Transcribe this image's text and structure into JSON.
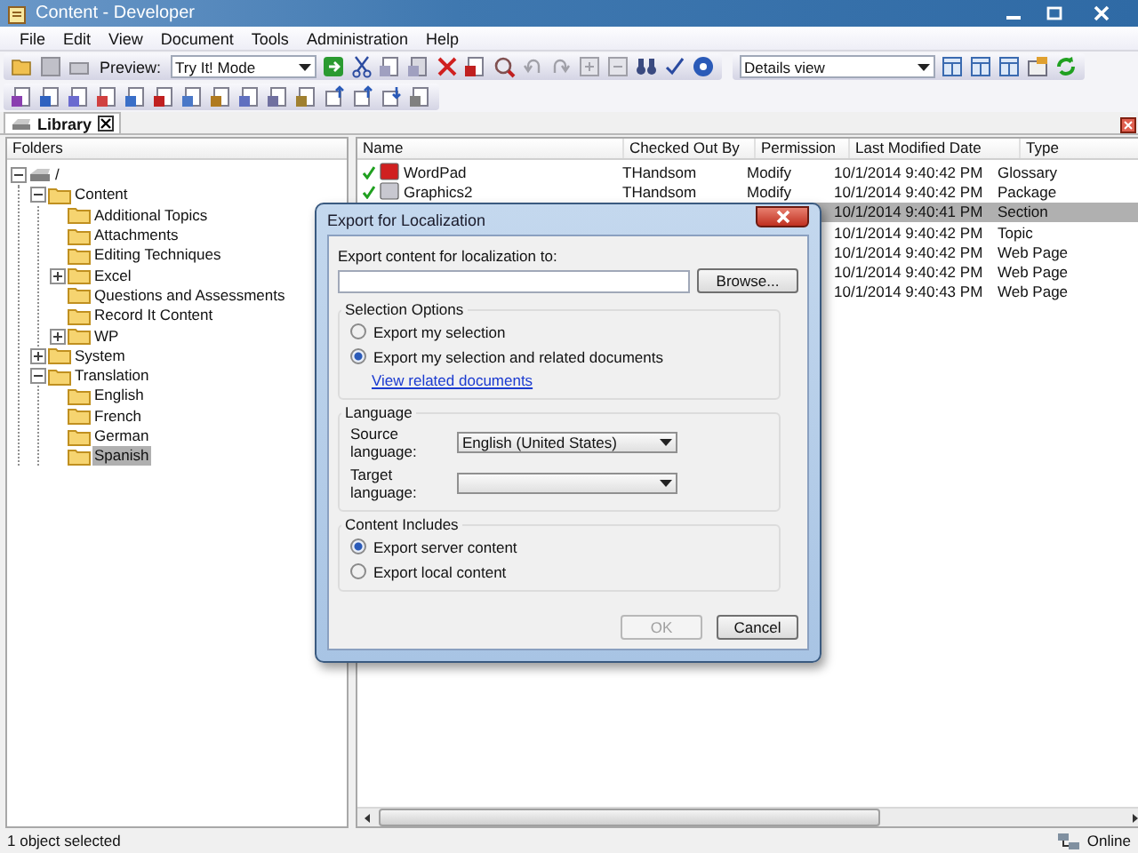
{
  "window": {
    "title": "Content - Developer"
  },
  "menu": [
    "File",
    "Edit",
    "View",
    "Document",
    "Tools",
    "Administration",
    "Help"
  ],
  "toolbar": {
    "preview_label": "Preview:",
    "preview_mode": "Try It! Mode",
    "view_mode": "Details view"
  },
  "tabs": [
    {
      "label": "Library",
      "selected": true
    }
  ],
  "folders": {
    "title": "Folders",
    "tree": [
      {
        "label": "/",
        "expanded": true,
        "selected": false,
        "children": [
          {
            "label": "Content",
            "expanded": true,
            "selected": false,
            "children": [
              {
                "label": "Additional Topics",
                "selected": false
              },
              {
                "label": "Attachments",
                "selected": false
              },
              {
                "label": "Editing Techniques",
                "selected": false
              },
              {
                "label": "Excel",
                "expanded": false,
                "selected": false
              },
              {
                "label": "Questions and Assessments",
                "selected": false
              },
              {
                "label": "Record It Content",
                "selected": false
              },
              {
                "label": "WP",
                "expanded": false,
                "selected": false
              }
            ]
          },
          {
            "label": "System",
            "expanded": false,
            "selected": false
          },
          {
            "label": "Translation",
            "expanded": true,
            "selected": false,
            "children": [
              {
                "label": "English",
                "selected": false
              },
              {
                "label": "French",
                "selected": false
              },
              {
                "label": "German",
                "selected": false
              },
              {
                "label": "Spanish",
                "selected": true
              }
            ]
          }
        ]
      }
    ]
  },
  "documents": {
    "columns": [
      "Name",
      "Checked Out By",
      "Permission",
      "Last Modified Date",
      "Type"
    ],
    "rows": [
      {
        "name": "WordPad",
        "checked_out_by": "THandsom",
        "permission": "Modify",
        "modified": "10/1/2014 9:40:42 PM",
        "type": "Glossary",
        "checked_out": true,
        "selected": false
      },
      {
        "name": "Graphics2",
        "checked_out_by": "THandsom",
        "permission": "Modify",
        "modified": "10/1/2014 9:40:42 PM",
        "type": "Package",
        "checked_out": true,
        "selected": false
      },
      {
        "modified": "10/1/2014 9:40:41 PM",
        "type": "Section",
        "selected": true
      },
      {
        "modified": "10/1/2014 9:40:42 PM",
        "type": "Topic",
        "selected": false
      },
      {
        "modified": "10/1/2014 9:40:42 PM",
        "type": "Web Page",
        "selected": false
      },
      {
        "modified": "10/1/2014 9:40:42 PM",
        "type": "Web Page",
        "selected": false
      },
      {
        "modified": "10/1/2014 9:40:43 PM",
        "type": "Web Page",
        "selected": false
      }
    ]
  },
  "dialog": {
    "title": "Export for Localization",
    "destination_label": "Export content for localization to:",
    "browse_button": "Browse...",
    "selection_options": {
      "title": "Selection Options",
      "options": [
        {
          "label": "Export my selection",
          "selected": false
        },
        {
          "label": "Export my selection and related documents",
          "selected": true
        }
      ],
      "link": "View related documents"
    },
    "language": {
      "title": "Language",
      "source_label": "Source language:",
      "source_value": "English (United States)",
      "target_label": "Target language:"
    },
    "content_includes": {
      "title": "Content Includes",
      "options": [
        {
          "label": "Export server content",
          "selected": true
        },
        {
          "label": "Export local content",
          "selected": false
        }
      ]
    },
    "buttons": [
      {
        "label": "OK",
        "disabled": true
      },
      {
        "label": "Cancel",
        "disabled": false
      }
    ]
  },
  "status_bar": {
    "message": "1 object selected",
    "connection": "Online"
  }
}
